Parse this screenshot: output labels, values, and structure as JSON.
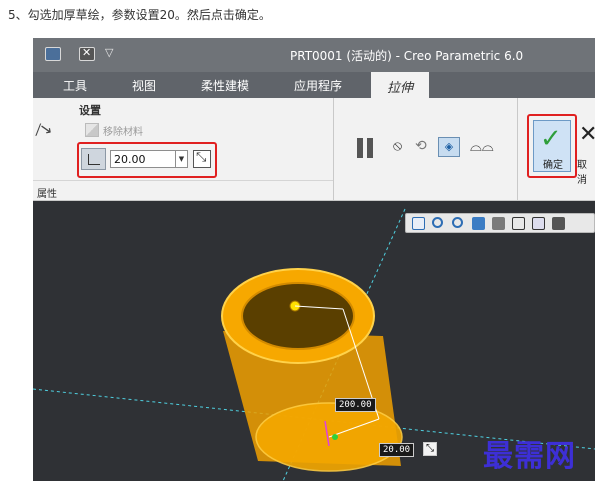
{
  "caption": "5、勾选加厚草绘，参数设置20。然后点击确定。",
  "window": {
    "title": "PRT0001 (活动的) - Creo Parametric 6.0"
  },
  "tabs": [
    {
      "label": "工具"
    },
    {
      "label": "视图"
    },
    {
      "label": "柔性建模"
    },
    {
      "label": "应用程序"
    },
    {
      "label": "拉伸"
    }
  ],
  "ribbon": {
    "settings_title": "设置",
    "remove_material": "移除材料",
    "depth_value": "20.00",
    "properties": "属性",
    "ok_label": "确定",
    "cancel_label": "取消"
  },
  "viewport": {
    "dim_height": "200.00",
    "dim_thickness": "20.00"
  },
  "watermark": "最需网",
  "colors": {
    "highlight_box": "#e02020",
    "model": "#f5a300",
    "ok_check": "#2e9e3a"
  }
}
